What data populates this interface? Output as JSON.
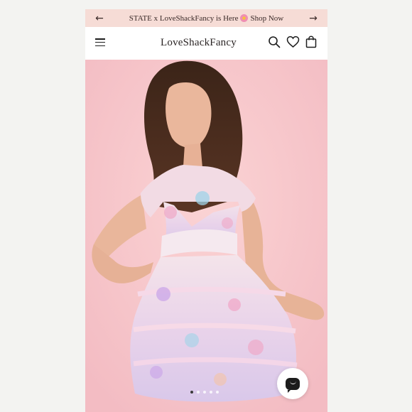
{
  "promo": {
    "text_before": "STATE x LoveShackFancy is Here",
    "link": "Shop Now",
    "prev_icon": "arrow-left-icon",
    "next_icon": "arrow-right-icon"
  },
  "header": {
    "logo": "LoveShackFancy",
    "icons": [
      "menu-icon",
      "search-icon",
      "heart-icon",
      "bag-icon"
    ]
  },
  "hero": {
    "subject": "model in pastel floral tiered ruffle mini dress",
    "carousel": {
      "total": 5,
      "current": 1
    },
    "chat_icon": "chat-icon"
  },
  "colors": {
    "promo_bg": "#f6dcd6",
    "hero_bg": "#f8c9cc",
    "text": "#2a2424"
  }
}
